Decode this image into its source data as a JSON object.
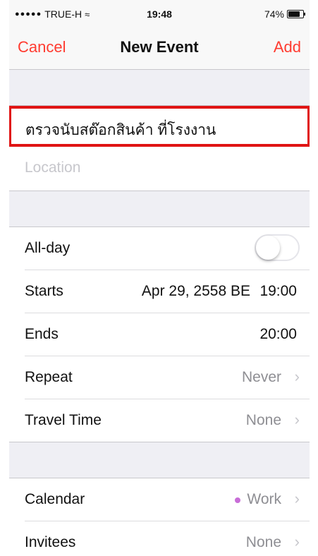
{
  "status": {
    "carrier": "TRUE-H",
    "time": "19:48",
    "battery": "74%",
    "battery_level": 0.74
  },
  "nav": {
    "cancel": "Cancel",
    "title": "New Event",
    "add": "Add"
  },
  "event": {
    "title_value": "ตรวจนับสต๊อกสินค้า ที่โรงงาน",
    "location_placeholder": "Location"
  },
  "rows": {
    "allday_label": "All-day",
    "allday_on": false,
    "starts_label": "Starts",
    "starts_date": "Apr 29, 2558 BE",
    "starts_time": "19:00",
    "ends_label": "Ends",
    "ends_time": "20:00",
    "repeat_label": "Repeat",
    "repeat_value": "Never",
    "travel_label": "Travel Time",
    "travel_value": "None",
    "calendar_label": "Calendar",
    "calendar_value": "Work",
    "calendar_color": "#c86dd7",
    "invitees_label": "Invitees",
    "invitees_value": "None"
  },
  "colors": {
    "accent": "#ff3b30",
    "highlight_border": "#e01414"
  }
}
